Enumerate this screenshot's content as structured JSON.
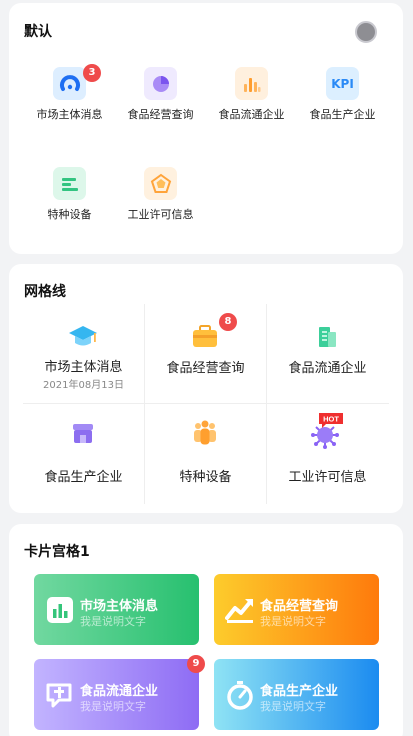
{
  "colors": {
    "page_bg": "#f2f3f5",
    "badge": "#ef4b4b",
    "tile_green": [
      "#71d8a0",
      "#27c06f"
    ],
    "tile_orange": [
      "#fdcc2c",
      "#fe7a0c"
    ],
    "tile_purple": [
      "#c2b4ff",
      "#8e6cf4"
    ],
    "tile_blue": [
      "#8fe3f4",
      "#1b8bf0"
    ]
  },
  "default_section": {
    "title": "默认",
    "items": [
      {
        "label": "市场主体消息",
        "icon": "gauge-icon",
        "badge": "3"
      },
      {
        "label": "食品经营查询",
        "icon": "pie-chart-icon",
        "badge": ""
      },
      {
        "label": "食品流通企业",
        "icon": "bar-chart-icon",
        "badge": ""
      },
      {
        "label": "食品生产企业",
        "icon": "kpi-icon",
        "icon_text": "KPI",
        "badge": ""
      },
      {
        "label": "特种设备",
        "icon": "list-icon",
        "badge": ""
      },
      {
        "label": "工业许可信息",
        "icon": "pentagon-icon",
        "badge": ""
      }
    ]
  },
  "grid_section": {
    "title": "网格线",
    "items": [
      {
        "label": "市场主体消息",
        "sub": "2021年08月13日",
        "icon": "graduation-cap-icon",
        "badge": ""
      },
      {
        "label": "食品经营查询",
        "sub": "",
        "icon": "briefcase-icon",
        "badge": "8"
      },
      {
        "label": "食品流通企业",
        "sub": "",
        "icon": "building-icon",
        "badge": ""
      },
      {
        "label": "食品生产企业",
        "sub": "",
        "icon": "shop-icon",
        "badge": ""
      },
      {
        "label": "特种设备",
        "sub": "",
        "icon": "people-icon",
        "badge": ""
      },
      {
        "label": "工业许可信息",
        "sub": "",
        "icon": "virus-hot-icon",
        "icon_text": "HOT",
        "badge": ""
      }
    ]
  },
  "card_section": {
    "title": "卡片宫格1",
    "items": [
      {
        "title": "市场主体消息",
        "desc": "我是说明文字",
        "icon": "bar-chart-icon",
        "badge": ""
      },
      {
        "title": "食品经营查询",
        "desc": "我是说明文字",
        "icon": "trend-icon",
        "badge": ""
      },
      {
        "title": "食品流通企业",
        "desc": "我是说明文字",
        "icon": "chat-icon",
        "badge": "9"
      },
      {
        "title": "食品生产企业",
        "desc": "我是说明文字",
        "icon": "stopwatch-icon",
        "badge": ""
      }
    ]
  }
}
